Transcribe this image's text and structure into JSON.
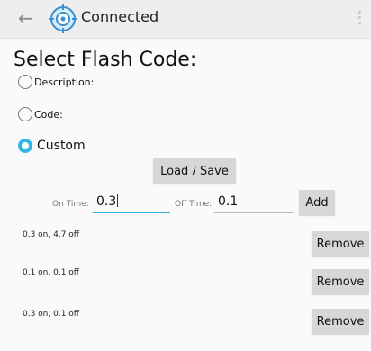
{
  "action_bar": {
    "back_icon": "arrow-left-icon",
    "logo_icon": "crosshair-target-icon",
    "title": "Connected",
    "overflow_icon": "more-vertical-icon"
  },
  "heading": "Select Flash Code:",
  "options": [
    {
      "label": "Description:",
      "selected": false
    },
    {
      "label": "Code:",
      "selected": false
    },
    {
      "label": "Custom",
      "selected": true
    }
  ],
  "load_save_label": "Load / Save",
  "on_time": {
    "label": "On Time:",
    "value": "0.3"
  },
  "off_time": {
    "label": "Off Time:",
    "value": "0.1"
  },
  "add_label": "Add",
  "sequences": [
    {
      "text": "0.3 on, 4.7 off",
      "remove_label": "Remove"
    },
    {
      "text": "0.1 on, 0.1 off",
      "remove_label": "Remove"
    },
    {
      "text": "0.3 on, 0.1 off",
      "remove_label": "Remove"
    }
  ],
  "colors": {
    "accent": "#33b5e5",
    "action_bar": "#eeeeee",
    "button": "#d7d7d7"
  }
}
